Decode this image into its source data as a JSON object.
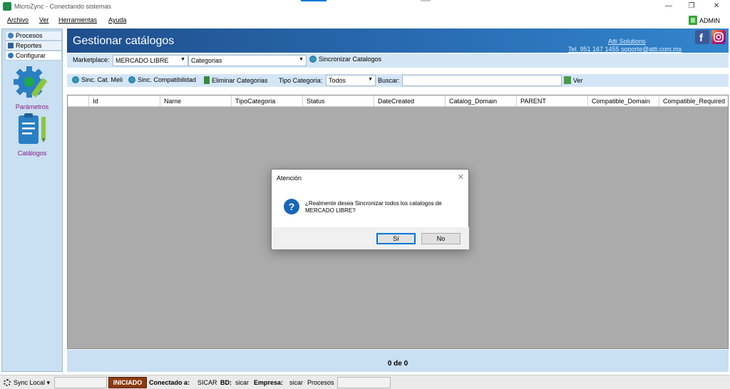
{
  "window": {
    "title": "MicroZync - Conectando sistemas"
  },
  "menu": {
    "items": [
      "Archivo",
      "Ver",
      "Herramientas",
      "Ayuda"
    ],
    "user": "ADMIN"
  },
  "left_tabs": [
    "Procesos",
    "Reportes",
    "Configurar"
  ],
  "left_items": [
    "Parámetros",
    "Catálogos"
  ],
  "banner": {
    "title": "Gestionar catálogos",
    "company": "Atti Solutions",
    "contact": "Tel. 951 167 1455  soporte@atti.com.mx"
  },
  "toolbar1": {
    "marketplace_label": "Marketplace:",
    "marketplace_value": "MERCADO LIBRE",
    "category_value": "Categorias",
    "sync_label": "Sincronizar Catalogos"
  },
  "toolbar2": {
    "sinc_cat": "Sinc. Cat. Meli",
    "sinc_compat": "Sinc. Compatibilidad",
    "eliminar": "Eliminar Categorias",
    "tipo_label": "Tipo Categoria:",
    "tipo_value": "Todos",
    "buscar_label": "Buscar:",
    "buscar_value": "",
    "ver_label": "Ver"
  },
  "grid": {
    "columns": [
      "Id",
      "Name",
      "TipoCategoria",
      "Status",
      "DateCreated",
      "Catalog_Domain",
      "PARENT",
      "Compatible_Domain",
      "Compatible_Required"
    ]
  },
  "pager": {
    "text": "0 de 0"
  },
  "status": {
    "sync_label": "Sync Local",
    "state": "INICIADO",
    "connected_label": "Conectado a:",
    "connected_value": "SICAR",
    "bd_label": "BD:",
    "bd_value": "sicar",
    "empresa_label": "Empresa:",
    "empresa_value": "sicar",
    "procesos_label": "Procesos"
  },
  "dialog": {
    "title": "Atención",
    "message": "¿Realmente desea Sincronizar todos los catalogos de MERCADO LIBRE?",
    "yes": "Sí",
    "no": "No"
  },
  "colors": {
    "banner": "#2a6fb6",
    "panel": "#c9dff2",
    "toolbar": "#d4e6f6",
    "grid_bg": "#ababab",
    "badge": "#8b3a12",
    "accent": "#0078d7"
  }
}
